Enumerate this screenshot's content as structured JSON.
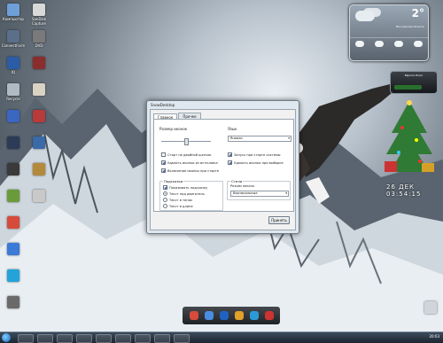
{
  "desktop": {
    "icons": [
      {
        "name": "Компьютер",
        "color": "#6f9fd8"
      },
      {
        "name": "ConnectForm",
        "color": "#5b6f8a"
      },
      {
        "name": "IQ",
        "color": "#2a5ca8"
      },
      {
        "name": "Recycle",
        "color": "#b0bac3"
      },
      {
        "name": "",
        "color": "#3967c1"
      },
      {
        "name": "",
        "color": "#2c3b56"
      },
      {
        "name": "",
        "color": "#3a3a3a"
      },
      {
        "name": "",
        "color": "#6a9b3a"
      },
      {
        "name": "",
        "color": "#d64b3b"
      },
      {
        "name": "",
        "color": "#3b7ad6"
      },
      {
        "name": "",
        "color": "#22a3d9"
      },
      {
        "name": "",
        "color": "#6a6a6a"
      }
    ],
    "icons_col2": [
      {
        "name": "SanDisk Capture",
        "color": "#d9d9d9"
      },
      {
        "name": "DVD",
        "color": "#7a7a7a"
      },
      {
        "name": "",
        "color": "#8c2d2d"
      },
      {
        "name": "",
        "color": "#d9d3c4"
      },
      {
        "name": "",
        "color": "#b83a3a"
      },
      {
        "name": "",
        "color": "#3a6aa8"
      },
      {
        "name": "",
        "color": "#b38a3a"
      },
      {
        "name": "",
        "color": "#c9c9c9"
      }
    ]
  },
  "weather": {
    "temp": "2°",
    "city": "Московская область"
  },
  "mini_gadget": {
    "title": "Европа Плюс",
    "level_fraction": 0.7
  },
  "clock_text": "26 ДЕК 03:54:15",
  "dialog": {
    "title": "SnowDesktop",
    "tabs": [
      {
        "label": "Главное",
        "active": true
      },
      {
        "label": "Прочее",
        "active": false
      }
    ],
    "size_label": "Размер иконок",
    "size_level": 0.5,
    "lang_label": "Язык",
    "lang_value": "Russian",
    "checkboxes_left": [
      {
        "label": "Старт на двойной щелчок",
        "checked": false
      },
      {
        "label": "Удалить иконки из источника",
        "checked": true
      },
      {
        "label": "Включение иконки при старте",
        "checked": true
      }
    ],
    "checkboxes_right": [
      {
        "label": "Запуск при старте системы",
        "checked": true
      },
      {
        "label": "Удалить иконки при выборке",
        "checked": true
      }
    ],
    "group_left": {
      "title": "Подсказки",
      "checkbox": {
        "label": "Показывать подсказку",
        "checked": true
      },
      "radios": [
        {
          "label": "Текст над двигатель",
          "on": true
        },
        {
          "label": "Текст в тенях",
          "on": false
        },
        {
          "label": "Текст в длине",
          "on": false
        }
      ]
    },
    "group_right": {
      "title": "Стили",
      "sublabel": "Режим показа",
      "select_value": "Вертикальные"
    },
    "ok_label": "Принять"
  },
  "taskbar": {
    "time": "20:03"
  }
}
